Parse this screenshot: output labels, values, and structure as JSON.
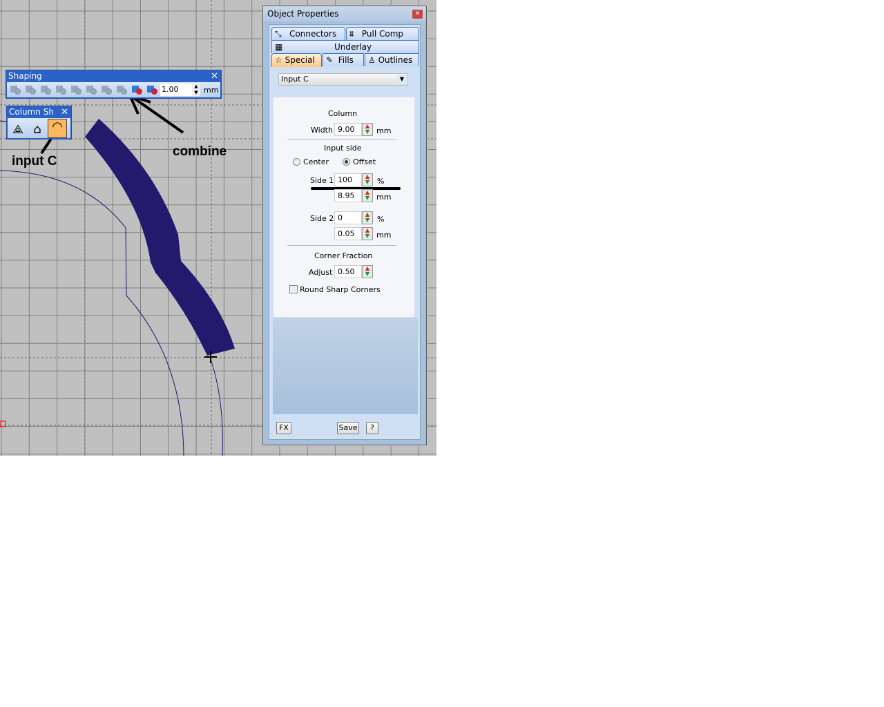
{
  "shaping_toolbar": {
    "title": "Shaping",
    "value": "1.00",
    "unit": "mm"
  },
  "column_toolbar": {
    "title": "Column Sh"
  },
  "annotations": {
    "combine": "combine",
    "input_c": "input C"
  },
  "dialog": {
    "title": "Object Properties",
    "tabs": [
      "Connectors",
      "Pull Comp",
      "Underlay",
      "Special",
      "Fills",
      "Outlines"
    ],
    "active_tab": "Special",
    "method": "Input C",
    "column_label": "Column",
    "width_label": "Width",
    "width": "9.00",
    "mm": "mm",
    "pct": "%",
    "input_side_label": "Input side",
    "center_label": "Center",
    "offset_label": "Offset",
    "selected_side": "Offset",
    "side1_label": "Side 1",
    "side1_pct": "100",
    "side1_mm": "8.95",
    "side2_label": "Side 2",
    "side2_pct": "0",
    "side2_mm": "0.05",
    "corner_label": "Corner Fraction",
    "adjust_label": "Adjust",
    "adjust": "0.50",
    "round_label": "Round Sharp Corners",
    "round_checked": false,
    "fx": "FX",
    "save": "Save",
    "help": "?"
  }
}
